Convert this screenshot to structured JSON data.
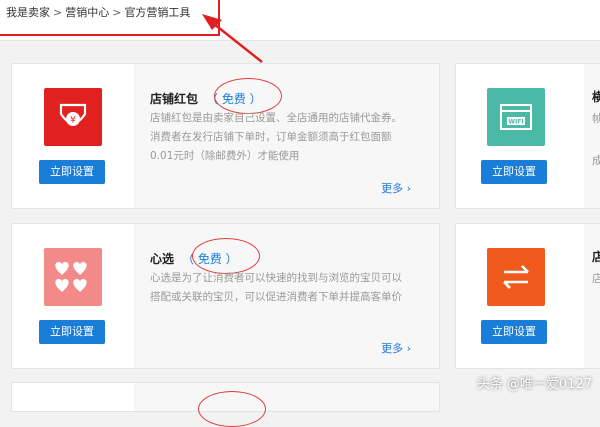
{
  "breadcrumb": {
    "items": [
      "我是卖家",
      "营销中心",
      "官方营销工具"
    ],
    "separator": ">"
  },
  "cards": [
    {
      "title": "店铺红包",
      "free": "（ 免费 ）",
      "desc": "店铺红包是由卖家自己设置、全店通用的店铺代金券。消费者在发行店铺下单时，订单金额须高于红包面额0.01元时（除邮费外）才能使用",
      "button": "立即设置",
      "more": "更多",
      "icon": "red-envelope-icon",
      "icon_color": "#e12020"
    },
    {
      "title": "心选",
      "free": "（ 免费 ）",
      "desc": "心选是为了让消费者可以快速的找到与浏览的宝贝可以搭配或关联的宝贝，可以促进消费者下单并提高客单价",
      "button": "立即设置",
      "more": "更多",
      "icon": "hearts-icon",
      "icon_color": "#f28a8a"
    }
  ],
  "right_cards": [
    {
      "button": "立即设置",
      "icon": "wifi-store-icon",
      "icon_color": "#4cb8a6",
      "partial_text": [
        "横",
        "帧",
        "成"
      ]
    },
    {
      "button": "立即设置",
      "icon": "swap-arrows-icon",
      "icon_color": "#f05a1c",
      "partial_text": [
        "店",
        "店"
      ]
    }
  ],
  "watermark": "头条 @唯一爱0127"
}
